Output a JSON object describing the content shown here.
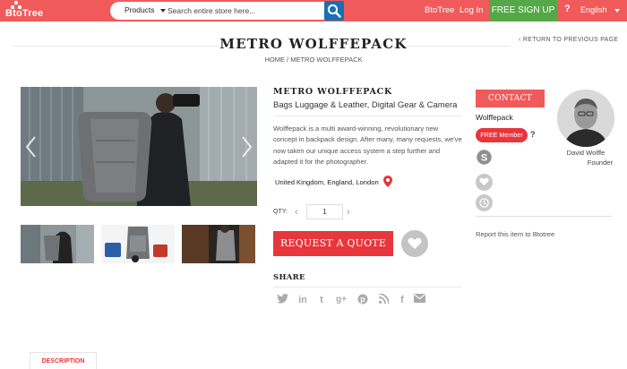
{
  "header": {
    "logo_text": "BtoTree",
    "search_category": "Products",
    "search_placeholder": "Search entire store here...",
    "nav_brand": "BtoTree",
    "nav_login": "Log In",
    "signup_label": "FREE SIGN UP",
    "help_glyph": "?",
    "language": "English"
  },
  "page": {
    "title": "METRO WOLFFEPACK",
    "breadcrumb": "HOME / METRO WOLFFEPACK",
    "return_link": "RETURN TO PREVIOUS PAGE"
  },
  "product": {
    "name": "METRO WOLFFEPACK",
    "category": "Bags Luggage & Leather, Digital Gear & Camera",
    "description": "Wolffepack is a multi award-winning, revolutionary new concept in backpack design. After many, many requests, we've now taken our unique access system a step further and adapted it for the photographer.",
    "location": "United Kingdom, England, London",
    "qty_label": "QTY:",
    "qty_value": "1",
    "quote_label": "REQUEST A QUOTE",
    "share_label": "SHARE",
    "share_icons": [
      "twitter-icon",
      "linkedin-icon",
      "tumblr-icon",
      "google-plus-icon",
      "pinterest-icon",
      "rss-icon",
      "facebook-icon",
      "email-icon"
    ]
  },
  "seller": {
    "contact_label": "CONTACT",
    "company": "Wolffepack",
    "member_badge": "FREE Member",
    "owner_name": "David Wolffe",
    "owner_role": "Founder",
    "report_text": "Report this item to Btotree"
  },
  "tabs": {
    "description": "DESCRIPTION"
  },
  "colors": {
    "topbar": "#f05a5a",
    "signup": "#55a847",
    "search_button": "#1a6fb5",
    "accent_red": "#e8363d"
  }
}
